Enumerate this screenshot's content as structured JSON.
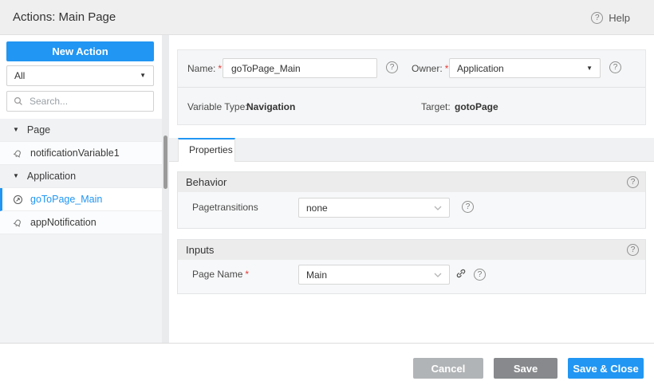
{
  "icons": {
    "help_glyph": "?",
    "caret_down": "▼"
  },
  "misc": {
    "required_marker": "*"
  },
  "header": {
    "title": "Actions: Main Page",
    "help_label": "Help"
  },
  "sidebar": {
    "new_action_label": "New Action",
    "filter_value": "All",
    "search_placeholder": "Search...",
    "tree": [
      {
        "kind": "group",
        "label": "Page"
      },
      {
        "kind": "item",
        "icon": "notification-icon",
        "label": "notificationVariable1",
        "selected": false
      },
      {
        "kind": "group",
        "label": "Application"
      },
      {
        "kind": "item",
        "icon": "goto-page-icon",
        "label": "goToPage_Main",
        "selected": true
      },
      {
        "kind": "item",
        "icon": "notification-icon",
        "label": "appNotification",
        "selected": false
      }
    ]
  },
  "form": {
    "name_label": "Name:",
    "name_value": "goToPage_Main",
    "owner_label": "Owner:",
    "owner_value": "Application",
    "variable_type_label": "Variable Type:",
    "variable_type_value": "Navigation",
    "target_label": "Target:",
    "target_value": "gotoPage"
  },
  "tabs": [
    {
      "label": "Properties",
      "active": true
    }
  ],
  "sections": {
    "behavior": {
      "title": "Behavior",
      "fields": [
        {
          "label": "Pagetransitions",
          "required": false,
          "value": "none"
        }
      ]
    },
    "inputs": {
      "title": "Inputs",
      "fields": [
        {
          "label": "Page Name",
          "required": true,
          "value": "Main"
        }
      ]
    }
  },
  "footer": {
    "cancel_label": "Cancel",
    "save_label": "Save",
    "save_close_label": "Save & Close"
  },
  "colors": {
    "accent": "#2196f3",
    "cancel_button": "#b1b4b6",
    "save_button": "#87898c",
    "required": "#e53935",
    "selected_tree_text": "#2196f3",
    "header_background": "#efefef",
    "section_header_background": "#ececec"
  }
}
